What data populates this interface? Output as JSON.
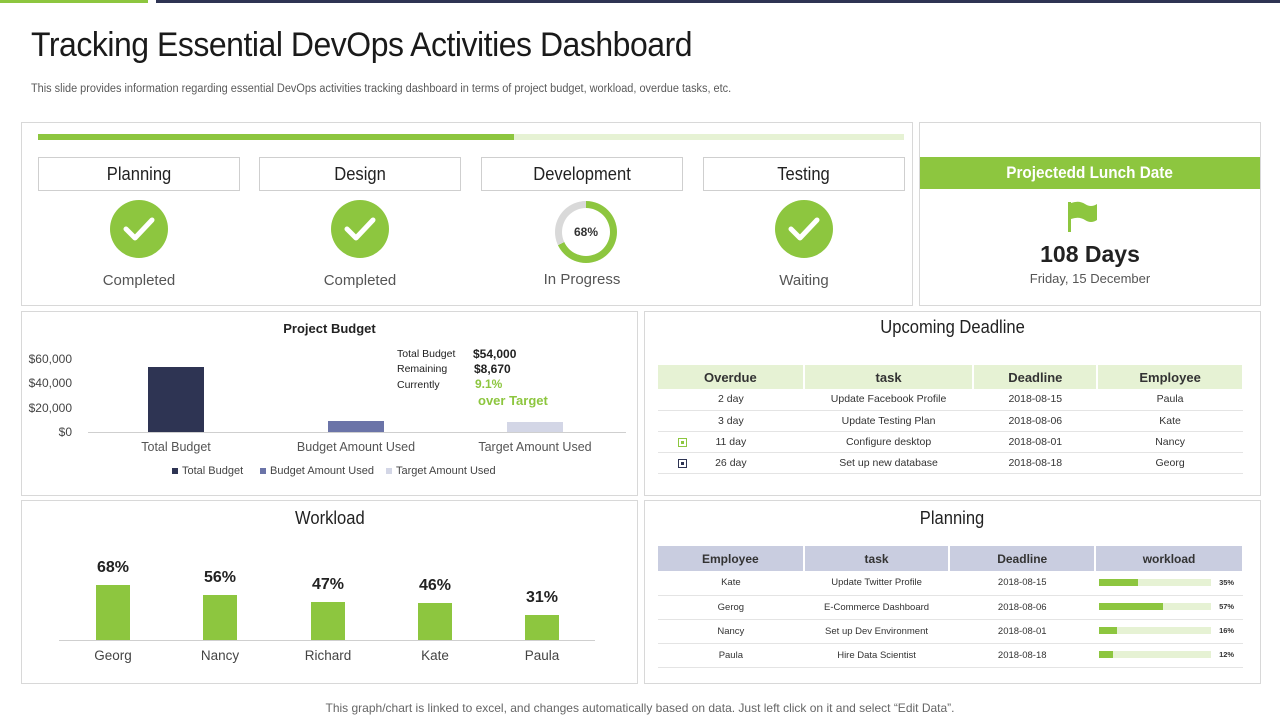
{
  "header": {
    "title": "Tracking Essential DevOps Activities Dashboard",
    "subtitle": "This slide provides information regarding essential DevOps activities tracking dashboard in terms of project budget, workload, overdue tasks, etc."
  },
  "colors": {
    "accent_green": "#8dc63f",
    "light_green": "#e6f2d4",
    "navy": "#2e3453",
    "lavender": "#c9cde0"
  },
  "stages": {
    "overall_progress": 0.55,
    "items": [
      {
        "name": "Planning",
        "status": "Completed",
        "icon": "check-icon"
      },
      {
        "name": "Design",
        "status": "Completed",
        "icon": "check-icon"
      },
      {
        "name": "Development",
        "status": "In Progress",
        "percent_label": "68%",
        "percent": 68
      },
      {
        "name": "Testing",
        "status": "Waiting",
        "icon": "check-icon"
      }
    ]
  },
  "launch": {
    "title": "Projectedd Lunch Date",
    "icon": "flag-icon",
    "days": "108 Days",
    "date": "Friday, 15 December"
  },
  "budget": {
    "title": "Project Budget",
    "summary": {
      "total_label": "Total Budget",
      "total_value": "$54,000",
      "remaining_label": "Remaining",
      "remaining_value": "$8,670",
      "currently_label": "Currently",
      "currently_value": "9.1%",
      "target_note": "over Target"
    },
    "legend": [
      "Total Budget",
      "Budget Amount Used",
      "Target Amount Used"
    ]
  },
  "chart_data": [
    {
      "type": "bar",
      "title": "Project Budget",
      "categories": [
        "Total Budget",
        "Budget Amount Used",
        "Target Amount Used"
      ],
      "values": [
        54000,
        9500,
        8000
      ],
      "colors": [
        "#2e3453",
        "#6b74a8",
        "#d3d6e6"
      ],
      "yticks": [
        "$0",
        "$20,000",
        "$40,000",
        "$60,000"
      ],
      "ylim": [
        0,
        60000
      ]
    },
    {
      "type": "bar",
      "title": "Workload",
      "categories": [
        "Georg",
        "Nancy",
        "Richard",
        "Kate",
        "Paula"
      ],
      "values": [
        68,
        56,
        47,
        46,
        31
      ],
      "labels": [
        "68%",
        "56%",
        "47%",
        "46%",
        "31%"
      ],
      "ylim": [
        0,
        100
      ]
    }
  ],
  "deadline": {
    "title": "Upcoming Deadline",
    "columns": [
      "Overdue",
      "task",
      "Deadline",
      "Employee"
    ],
    "rows": [
      {
        "overdue": "2 day",
        "task": "Update Facebook Profile",
        "deadline": "2018-08-15",
        "employee": "Paula",
        "marker": ""
      },
      {
        "overdue": "3 day",
        "task": "Update Testing Plan",
        "deadline": "2018-08-06",
        "employee": "Kate",
        "marker": ""
      },
      {
        "overdue": "11 day",
        "task": "Configure desktop",
        "deadline": "2018-08-01",
        "employee": "Nancy",
        "marker": "green"
      },
      {
        "overdue": "26 day",
        "task": "Set up new database",
        "deadline": "2018-08-18",
        "employee": "Georg",
        "marker": "navy"
      }
    ]
  },
  "workload": {
    "title": "Workload"
  },
  "planning": {
    "title": "Planning",
    "columns": [
      "Employee",
      "task",
      "Deadline",
      "workload"
    ],
    "rows": [
      {
        "employee": "Kate",
        "task": "Update Twitter Profile",
        "deadline": "2018-08-15",
        "workload": "35%",
        "value": 35
      },
      {
        "employee": "Gerog",
        "task": "E-Commerce Dashboard",
        "deadline": "2018-08-06",
        "workload": "57%",
        "value": 57
      },
      {
        "employee": "Nancy",
        "task": "Set up Dev Environment",
        "deadline": "2018-08-01",
        "workload": "16%",
        "value": 16
      },
      {
        "employee": "Paula",
        "task": "Hire Data Scientist",
        "deadline": "2018-08-18",
        "workload": "12%",
        "value": 12
      }
    ]
  },
  "footer": "This graph/chart is linked to excel,  and changes automatically based on data. Just left click on it and select “Edit Data”."
}
